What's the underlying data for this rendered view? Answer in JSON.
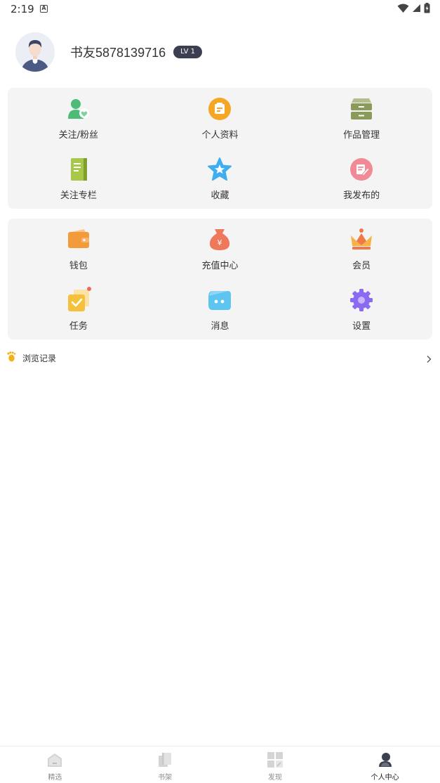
{
  "status_bar": {
    "time": "2:19",
    "notification_icon": "a-box-icon",
    "icons": [
      "wifi-icon",
      "cellular-icon",
      "battery-charging-icon"
    ]
  },
  "profile": {
    "username": "书友5878139716",
    "level": "LV 1",
    "avatar_icon": "user-avatar"
  },
  "card_1": {
    "items": [
      {
        "label": "关注/粉丝",
        "icon": "follow-fans-icon",
        "color": "#4cbc78"
      },
      {
        "label": "个人资料",
        "icon": "profile-info-icon",
        "color": "#f5a623"
      },
      {
        "label": "作品管理",
        "icon": "works-manage-icon",
        "color": "#8a9a5b"
      },
      {
        "label": "关注专栏",
        "icon": "column-book-icon",
        "color": "#a8c84a"
      },
      {
        "label": "收藏",
        "icon": "star-icon",
        "color": "#3eaef0"
      },
      {
        "label": "我发布的",
        "icon": "my-posts-icon",
        "color": "#f08a96"
      }
    ]
  },
  "card_2": {
    "items": [
      {
        "label": "钱包",
        "icon": "wallet-icon",
        "color": "#f39a3b"
      },
      {
        "label": "充值中心",
        "icon": "money-bag-icon",
        "color": "#f0785a"
      },
      {
        "label": "会员",
        "icon": "crown-icon",
        "color": "#f0794a"
      },
      {
        "label": "任务",
        "icon": "task-icon",
        "color": "#f5c03c",
        "has_dot": true
      },
      {
        "label": "消息",
        "icon": "message-icon",
        "color": "#5ec4f0"
      },
      {
        "label": "设置",
        "icon": "gear-icon",
        "color": "#8a6af0"
      }
    ]
  },
  "history": {
    "label": "浏览记录",
    "icon": "footprint-icon"
  },
  "bottom_nav": {
    "items": [
      {
        "label": "精选",
        "icon": "home-icon",
        "active": false
      },
      {
        "label": "书架",
        "icon": "bookshelf-icon",
        "active": false
      },
      {
        "label": "发现",
        "icon": "discover-icon",
        "active": false
      },
      {
        "label": "个人中心",
        "icon": "person-icon",
        "active": true
      }
    ]
  }
}
